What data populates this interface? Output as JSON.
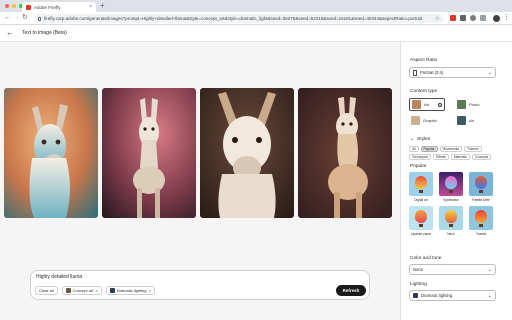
{
  "browser": {
    "tab_title": "Adobe Firefly",
    "tab_close": "×",
    "new_tab": "+",
    "url": "firefly.corp.adobe.com/generate/images?prompt=Highly+detailed+llama&style=concept_art&style=dramatic_light&seed=35275&seed=52216&seed=16181&seed=40344&aspectRatio=portrait",
    "back": "←",
    "forward": "→",
    "reload": "↻",
    "bookmark": "☆",
    "menu": "⋮"
  },
  "header": {
    "back_arrow": "←",
    "title": "Text to image (Beta)"
  },
  "prompt": {
    "text": "Highly detailed llama",
    "chips": [
      {
        "label": "Clear all"
      },
      {
        "label": "Concept art",
        "close": "×"
      },
      {
        "label": "Dramatic lighting",
        "close": "×"
      }
    ],
    "refresh_label": "Refresh"
  },
  "panel": {
    "aspect_ratio_label": "Aspect Ratio",
    "aspect_ratio_value": "Portrait (3:4)",
    "chevron": "⌄",
    "content_type_label": "Content type",
    "content_types": [
      {
        "label": "Art",
        "selected": true
      },
      {
        "label": "Photo",
        "selected": false
      },
      {
        "label": "Graphic",
        "selected": false
      },
      {
        "label": "Art",
        "selected": false
      }
    ],
    "styles_toggle": "⌄",
    "styles_label": "Styles",
    "style_tabs_row1": [
      "All",
      "Popular",
      "Movements",
      "Themes"
    ],
    "style_tabs_row2": [
      "Techniques",
      "Effects",
      "Materials",
      "Concepts"
    ],
    "popular_label": "Popular",
    "style_thumbs": [
      {
        "label": "Digital art"
      },
      {
        "label": "Synthwave"
      },
      {
        "label": "Palette knife"
      },
      {
        "label": "Layered paper"
      },
      {
        "label": "Neon"
      },
      {
        "label": "Chaotic"
      }
    ],
    "color_tone_label": "Color and tone",
    "color_tone_value": "None",
    "lighting_label": "Lighting",
    "lighting_value": "Dramatic lighting"
  },
  "colors": {
    "accent_dark": "#1a1a1a",
    "adobe_red": "#e8332a"
  }
}
